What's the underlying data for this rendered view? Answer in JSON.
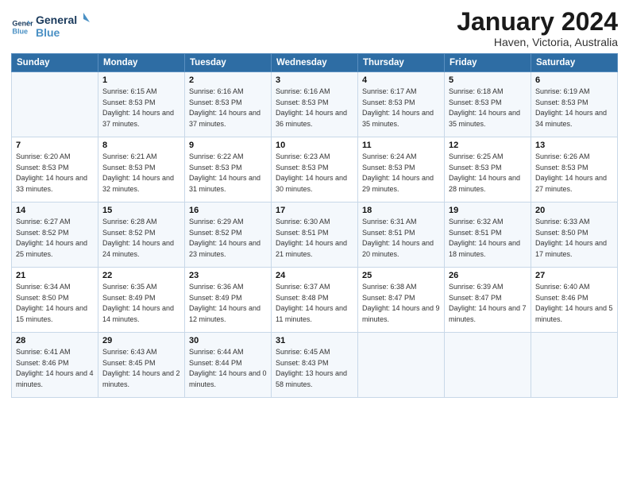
{
  "header": {
    "logo_line1": "General",
    "logo_line2": "Blue",
    "title": "January 2024",
    "subtitle": "Haven, Victoria, Australia"
  },
  "days_of_week": [
    "Sunday",
    "Monday",
    "Tuesday",
    "Wednesday",
    "Thursday",
    "Friday",
    "Saturday"
  ],
  "weeks": [
    [
      {
        "day": "",
        "sunrise": "",
        "sunset": "",
        "daylight": ""
      },
      {
        "day": "1",
        "sunrise": "Sunrise: 6:15 AM",
        "sunset": "Sunset: 8:53 PM",
        "daylight": "Daylight: 14 hours and 37 minutes."
      },
      {
        "day": "2",
        "sunrise": "Sunrise: 6:16 AM",
        "sunset": "Sunset: 8:53 PM",
        "daylight": "Daylight: 14 hours and 37 minutes."
      },
      {
        "day": "3",
        "sunrise": "Sunrise: 6:16 AM",
        "sunset": "Sunset: 8:53 PM",
        "daylight": "Daylight: 14 hours and 36 minutes."
      },
      {
        "day": "4",
        "sunrise": "Sunrise: 6:17 AM",
        "sunset": "Sunset: 8:53 PM",
        "daylight": "Daylight: 14 hours and 35 minutes."
      },
      {
        "day": "5",
        "sunrise": "Sunrise: 6:18 AM",
        "sunset": "Sunset: 8:53 PM",
        "daylight": "Daylight: 14 hours and 35 minutes."
      },
      {
        "day": "6",
        "sunrise": "Sunrise: 6:19 AM",
        "sunset": "Sunset: 8:53 PM",
        "daylight": "Daylight: 14 hours and 34 minutes."
      }
    ],
    [
      {
        "day": "7",
        "sunrise": "Sunrise: 6:20 AM",
        "sunset": "Sunset: 8:53 PM",
        "daylight": "Daylight: 14 hours and 33 minutes."
      },
      {
        "day": "8",
        "sunrise": "Sunrise: 6:21 AM",
        "sunset": "Sunset: 8:53 PM",
        "daylight": "Daylight: 14 hours and 32 minutes."
      },
      {
        "day": "9",
        "sunrise": "Sunrise: 6:22 AM",
        "sunset": "Sunset: 8:53 PM",
        "daylight": "Daylight: 14 hours and 31 minutes."
      },
      {
        "day": "10",
        "sunrise": "Sunrise: 6:23 AM",
        "sunset": "Sunset: 8:53 PM",
        "daylight": "Daylight: 14 hours and 30 minutes."
      },
      {
        "day": "11",
        "sunrise": "Sunrise: 6:24 AM",
        "sunset": "Sunset: 8:53 PM",
        "daylight": "Daylight: 14 hours and 29 minutes."
      },
      {
        "day": "12",
        "sunrise": "Sunrise: 6:25 AM",
        "sunset": "Sunset: 8:53 PM",
        "daylight": "Daylight: 14 hours and 28 minutes."
      },
      {
        "day": "13",
        "sunrise": "Sunrise: 6:26 AM",
        "sunset": "Sunset: 8:53 PM",
        "daylight": "Daylight: 14 hours and 27 minutes."
      }
    ],
    [
      {
        "day": "14",
        "sunrise": "Sunrise: 6:27 AM",
        "sunset": "Sunset: 8:52 PM",
        "daylight": "Daylight: 14 hours and 25 minutes."
      },
      {
        "day": "15",
        "sunrise": "Sunrise: 6:28 AM",
        "sunset": "Sunset: 8:52 PM",
        "daylight": "Daylight: 14 hours and 24 minutes."
      },
      {
        "day": "16",
        "sunrise": "Sunrise: 6:29 AM",
        "sunset": "Sunset: 8:52 PM",
        "daylight": "Daylight: 14 hours and 23 minutes."
      },
      {
        "day": "17",
        "sunrise": "Sunrise: 6:30 AM",
        "sunset": "Sunset: 8:51 PM",
        "daylight": "Daylight: 14 hours and 21 minutes."
      },
      {
        "day": "18",
        "sunrise": "Sunrise: 6:31 AM",
        "sunset": "Sunset: 8:51 PM",
        "daylight": "Daylight: 14 hours and 20 minutes."
      },
      {
        "day": "19",
        "sunrise": "Sunrise: 6:32 AM",
        "sunset": "Sunset: 8:51 PM",
        "daylight": "Daylight: 14 hours and 18 minutes."
      },
      {
        "day": "20",
        "sunrise": "Sunrise: 6:33 AM",
        "sunset": "Sunset: 8:50 PM",
        "daylight": "Daylight: 14 hours and 17 minutes."
      }
    ],
    [
      {
        "day": "21",
        "sunrise": "Sunrise: 6:34 AM",
        "sunset": "Sunset: 8:50 PM",
        "daylight": "Daylight: 14 hours and 15 minutes."
      },
      {
        "day": "22",
        "sunrise": "Sunrise: 6:35 AM",
        "sunset": "Sunset: 8:49 PM",
        "daylight": "Daylight: 14 hours and 14 minutes."
      },
      {
        "day": "23",
        "sunrise": "Sunrise: 6:36 AM",
        "sunset": "Sunset: 8:49 PM",
        "daylight": "Daylight: 14 hours and 12 minutes."
      },
      {
        "day": "24",
        "sunrise": "Sunrise: 6:37 AM",
        "sunset": "Sunset: 8:48 PM",
        "daylight": "Daylight: 14 hours and 11 minutes."
      },
      {
        "day": "25",
        "sunrise": "Sunrise: 6:38 AM",
        "sunset": "Sunset: 8:47 PM",
        "daylight": "Daylight: 14 hours and 9 minutes."
      },
      {
        "day": "26",
        "sunrise": "Sunrise: 6:39 AM",
        "sunset": "Sunset: 8:47 PM",
        "daylight": "Daylight: 14 hours and 7 minutes."
      },
      {
        "day": "27",
        "sunrise": "Sunrise: 6:40 AM",
        "sunset": "Sunset: 8:46 PM",
        "daylight": "Daylight: 14 hours and 5 minutes."
      }
    ],
    [
      {
        "day": "28",
        "sunrise": "Sunrise: 6:41 AM",
        "sunset": "Sunset: 8:46 PM",
        "daylight": "Daylight: 14 hours and 4 minutes."
      },
      {
        "day": "29",
        "sunrise": "Sunrise: 6:43 AM",
        "sunset": "Sunset: 8:45 PM",
        "daylight": "Daylight: 14 hours and 2 minutes."
      },
      {
        "day": "30",
        "sunrise": "Sunrise: 6:44 AM",
        "sunset": "Sunset: 8:44 PM",
        "daylight": "Daylight: 14 hours and 0 minutes."
      },
      {
        "day": "31",
        "sunrise": "Sunrise: 6:45 AM",
        "sunset": "Sunset: 8:43 PM",
        "daylight": "Daylight: 13 hours and 58 minutes."
      },
      {
        "day": "",
        "sunrise": "",
        "sunset": "",
        "daylight": ""
      },
      {
        "day": "",
        "sunrise": "",
        "sunset": "",
        "daylight": ""
      },
      {
        "day": "",
        "sunrise": "",
        "sunset": "",
        "daylight": ""
      }
    ]
  ]
}
